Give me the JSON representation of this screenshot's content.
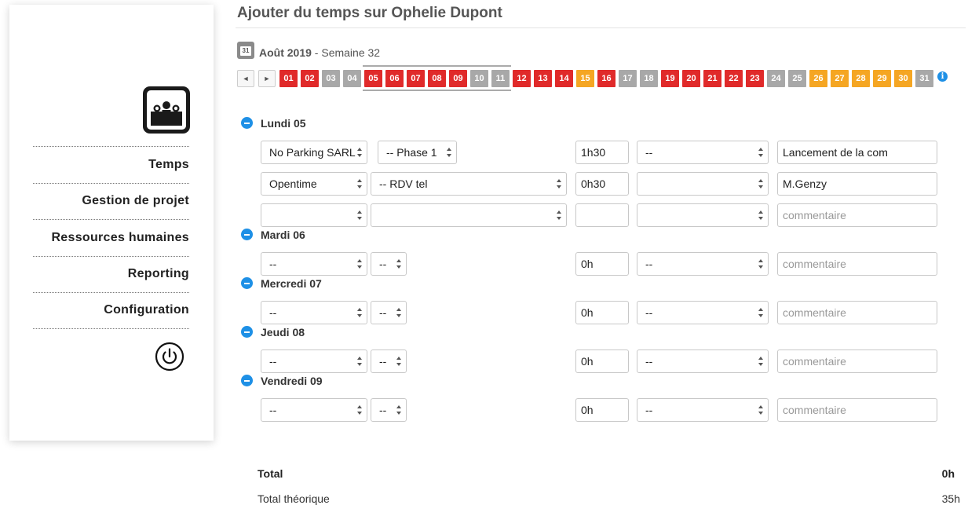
{
  "nav": {
    "items": [
      "Temps",
      "Gestion de projet",
      "Ressources humaines",
      "Reporting",
      "Configuration"
    ]
  },
  "header": {
    "title": "Ajouter du temps sur Ophelie Dupont",
    "calendar_icon_text": "31",
    "month": "Août 2019",
    "week": " - Semaine 32"
  },
  "day_strip": {
    "prev": "◄",
    "next": "►",
    "info": "i",
    "days": [
      {
        "label": "01",
        "status": "red"
      },
      {
        "label": "02",
        "status": "red"
      },
      {
        "label": "03",
        "status": "grey"
      },
      {
        "label": "04",
        "status": "grey"
      },
      {
        "label": "05",
        "status": "red"
      },
      {
        "label": "06",
        "status": "red"
      },
      {
        "label": "07",
        "status": "red"
      },
      {
        "label": "08",
        "status": "red"
      },
      {
        "label": "09",
        "status": "red"
      },
      {
        "label": "10",
        "status": "grey"
      },
      {
        "label": "11",
        "status": "grey"
      },
      {
        "label": "12",
        "status": "red"
      },
      {
        "label": "13",
        "status": "red"
      },
      {
        "label": "14",
        "status": "red"
      },
      {
        "label": "15",
        "status": "orange"
      },
      {
        "label": "16",
        "status": "red"
      },
      {
        "label": "17",
        "status": "grey"
      },
      {
        "label": "18",
        "status": "grey"
      },
      {
        "label": "19",
        "status": "red"
      },
      {
        "label": "20",
        "status": "red"
      },
      {
        "label": "21",
        "status": "red"
      },
      {
        "label": "22",
        "status": "red"
      },
      {
        "label": "23",
        "status": "red"
      },
      {
        "label": "24",
        "status": "grey"
      },
      {
        "label": "25",
        "status": "grey"
      },
      {
        "label": "26",
        "status": "orange"
      },
      {
        "label": "27",
        "status": "orange"
      },
      {
        "label": "28",
        "status": "orange"
      },
      {
        "label": "29",
        "status": "orange"
      },
      {
        "label": "30",
        "status": "orange"
      },
      {
        "label": "31",
        "status": "grey"
      }
    ]
  },
  "colors": {
    "red": "#e02a2a",
    "grey": "#a8a8a8",
    "orange": "#f5a623",
    "accent": "#1e90e6"
  },
  "days": [
    {
      "name": "Lundi 05",
      "rows": [
        {
          "client": "No Parking SARL",
          "phase": "-- Phase 1",
          "duration": "1h30",
          "task": "--",
          "comment": "Lancement de la com",
          "comment_placeholder": "commentaire"
        },
        {
          "client": "Opentime",
          "phase": "-- RDV tel",
          "duration": "0h30",
          "task": "",
          "comment": "M.Genzy",
          "comment_placeholder": "commentaire"
        },
        {
          "client": "",
          "phase": "",
          "duration": "",
          "task": "",
          "comment": "",
          "comment_placeholder": "commentaire"
        }
      ]
    },
    {
      "name": "Mardi 06",
      "rows": [
        {
          "client": "--",
          "phase": "--",
          "duration": "0h",
          "task": "--",
          "comment": "",
          "comment_placeholder": "commentaire"
        }
      ]
    },
    {
      "name": "Mercredi 07",
      "rows": [
        {
          "client": "--",
          "phase": "--",
          "duration": "0h",
          "task": "--",
          "comment": "",
          "comment_placeholder": "commentaire"
        }
      ]
    },
    {
      "name": "Jeudi 08",
      "rows": [
        {
          "client": "--",
          "phase": "--",
          "duration": "0h",
          "task": "--",
          "comment": "",
          "comment_placeholder": "commentaire"
        }
      ]
    },
    {
      "name": "Vendredi 09",
      "rows": [
        {
          "client": "--",
          "phase": "--",
          "duration": "0h",
          "task": "--",
          "comment": "",
          "comment_placeholder": "commentaire"
        }
      ]
    }
  ],
  "totals": {
    "total_label": "Total",
    "total_value": "0h",
    "theoretical_label": "Total théorique",
    "theoretical_value": "35h"
  }
}
